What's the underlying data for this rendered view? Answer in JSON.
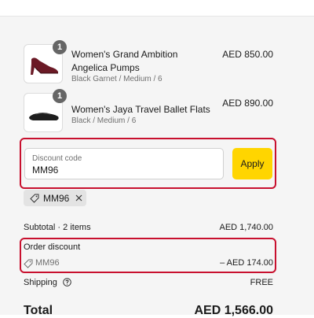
{
  "cart": {
    "items": [
      {
        "quantity": "1",
        "name": "Women's Grand Ambition Angelica Pumps",
        "variant": "Black Garnet / Medium / 6",
        "price": "AED 850.00"
      },
      {
        "quantity": "1",
        "name": "Women's Jaya Travel Ballet Flats",
        "variant": "Black / Medium / 6",
        "price": "AED 890.00"
      }
    ]
  },
  "discount": {
    "label": "Discount code",
    "value": "MM96",
    "apply_label": "Apply",
    "applied_tag": "MM96"
  },
  "summary": {
    "subtotal_label": "Subtotal · 2 items",
    "subtotal_value": "AED 1,740.00",
    "order_discount_label": "Order discount",
    "order_discount_code": "MM96",
    "order_discount_value": "– AED 174.00",
    "shipping_label": "Shipping",
    "shipping_value": "FREE",
    "total_label": "Total",
    "total_value": "AED 1,566.00"
  },
  "colors": {
    "highlight": "#c8102e",
    "apply_button": "#ffd500",
    "panel_bg": "#f5f5f5"
  },
  "icons": [
    "tag-icon",
    "close-icon",
    "help-icon"
  ]
}
